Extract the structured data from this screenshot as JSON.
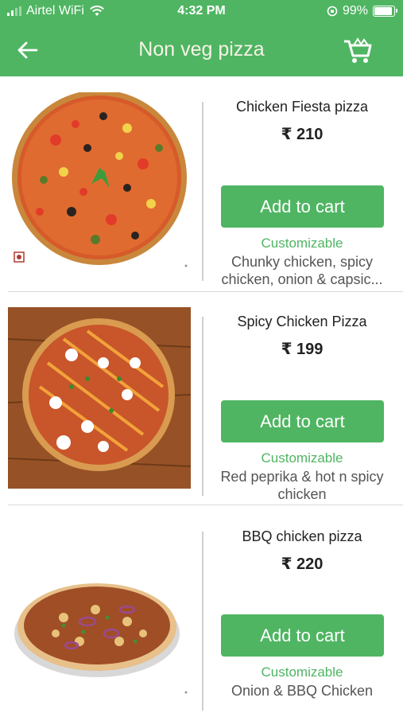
{
  "status_bar": {
    "carrier": "Airtel WiFi",
    "time": "4:32 PM",
    "battery": "99%"
  },
  "header": {
    "title": "Non veg pizza",
    "back_icon": "back-arrow-icon",
    "cart_icon": "shopping-cart-icon"
  },
  "items": [
    {
      "name": "Chicken Fiesta pizza",
      "price": "₹ 210",
      "button": "Add to cart",
      "customizable": "Customizable",
      "description": "Chunky chicken, spicy chicken, onion & capsic..."
    },
    {
      "name": "Spicy Chicken Pizza",
      "price": "₹ 199",
      "button": "Add to cart",
      "customizable": "Customizable",
      "description": "Red peprika & hot n spicy chicken"
    },
    {
      "name": "BBQ chicken pizza",
      "price": "₹ 220",
      "button": "Add to cart",
      "customizable": "Customizable",
      "description": "Onion & BBQ Chicken"
    }
  ],
  "colors": {
    "brand": "#4fb562",
    "title_text": "#f7f3e6",
    "veg_mark": "#b03a2e"
  }
}
